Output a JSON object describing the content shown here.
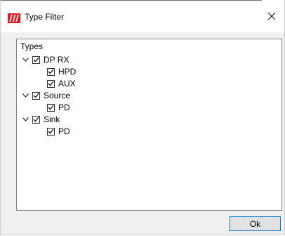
{
  "window": {
    "title": "Type Filter",
    "app_icon": "app-logo-icon",
    "close_icon": "close-icon"
  },
  "filter": {
    "group_label": "Types",
    "tree": [
      {
        "label": "DP RX",
        "expanded": true,
        "checked": true,
        "children": [
          {
            "label": "HPD",
            "checked": true
          },
          {
            "label": "AUX",
            "checked": true
          }
        ]
      },
      {
        "label": "Source",
        "expanded": true,
        "checked": true,
        "children": [
          {
            "label": "PD",
            "checked": true
          }
        ]
      },
      {
        "label": "Sink",
        "expanded": true,
        "checked": true,
        "children": [
          {
            "label": "PD",
            "checked": true
          }
        ]
      }
    ]
  },
  "footer": {
    "ok_label": "Ok"
  },
  "colors": {
    "accent_border": "#0078d7",
    "logo_red": "#e01b22"
  }
}
